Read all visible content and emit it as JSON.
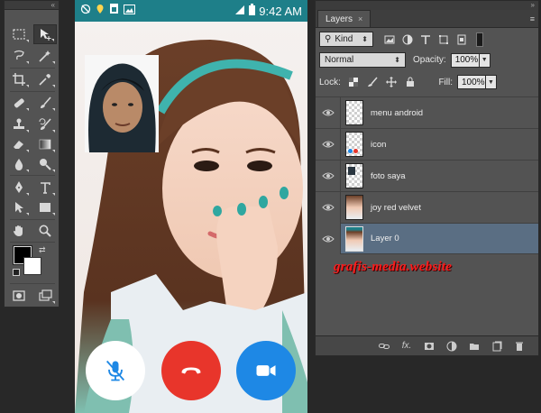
{
  "tools": {
    "collapse": "«",
    "items": [
      "marquee",
      "move",
      "lasso",
      "magic-wand",
      "crop",
      "eyedropper",
      "healing-brush",
      "brush",
      "clone-stamp",
      "history-brush",
      "eraser",
      "gradient",
      "blur",
      "dodge",
      "pen",
      "type",
      "path-selection",
      "rectangle",
      "hand",
      "zoom"
    ],
    "foreground_color": "#000000",
    "background_color": "#ffffff"
  },
  "phone": {
    "status_time": "9:42 AM",
    "status_bar_color": "#1e7f89"
  },
  "call_buttons": {
    "mute_color": "#ffffff",
    "end_color": "#e8352b",
    "video_color": "#1e88e5"
  },
  "layers_panel": {
    "collapse": "»",
    "tab_title": "Layers",
    "tab_close": "×",
    "filter_kind": "Kind",
    "blend_mode": "Normal",
    "opacity_label": "Opacity:",
    "opacity_value": "100%",
    "lock_label": "Lock:",
    "fill_label": "Fill:",
    "fill_value": "100%",
    "layers": [
      {
        "name": "menu android",
        "selected": false
      },
      {
        "name": "icon",
        "selected": false
      },
      {
        "name": "foto saya",
        "selected": false
      },
      {
        "name": "joy red velvet",
        "selected": false
      },
      {
        "name": "Layer 0",
        "selected": true
      }
    ],
    "footer_fx": "fx."
  },
  "watermark": "grafis-media.website"
}
